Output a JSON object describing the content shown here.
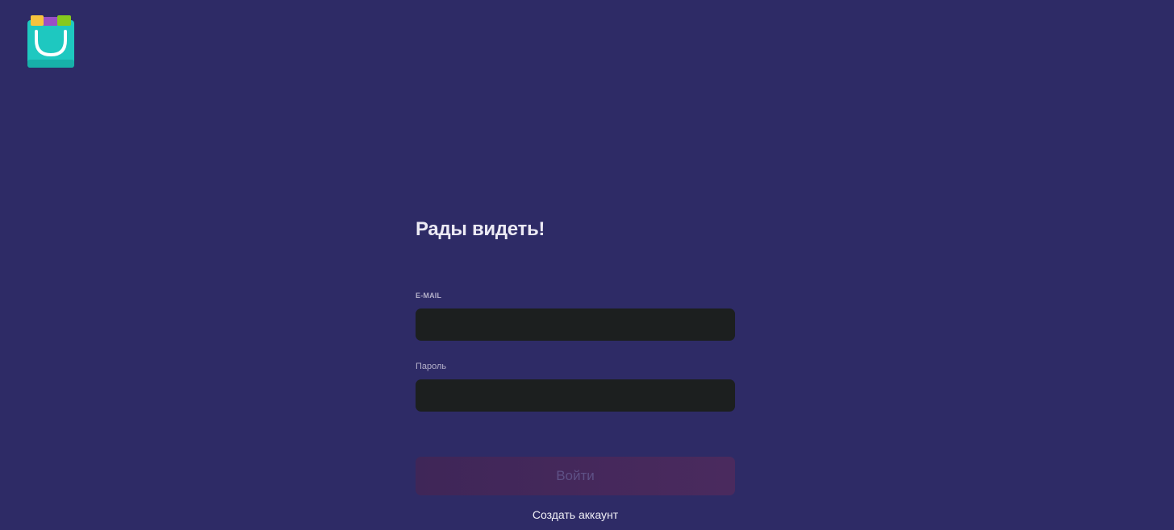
{
  "logo": {
    "icon": "shopping-bag-icon"
  },
  "login": {
    "title": "Рады видеть!",
    "email_label": "E-MAIL",
    "email_value": "",
    "password_label": "Пароль",
    "password_value": "",
    "submit_label": "Войти",
    "register_link": "Создать аккаунт"
  },
  "colors": {
    "background": "#2e2b66",
    "input_background": "#1c1f1f",
    "button_background": "#442860",
    "logo_teal": "#1ec8c0"
  }
}
